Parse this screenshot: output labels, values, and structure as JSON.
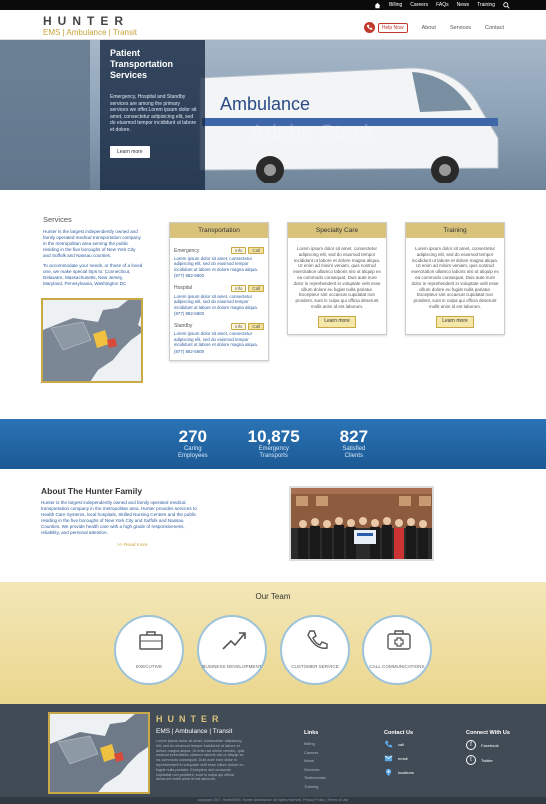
{
  "topbar": {
    "links": [
      "Billing",
      "Careers",
      "FAQs",
      "News",
      "Training"
    ]
  },
  "header": {
    "title": "HUNTER",
    "subtitle": "EMS | Ambulance | Transit",
    "help_label": "Help Now",
    "nav": [
      "About",
      "Services",
      "Contact"
    ]
  },
  "hero": {
    "title": "Patient Transportation Services",
    "text": "Emergency, Hospital and Standby services are among the primary services we offer.Lorem ipsum dolor sit amet, consectetur adipisicing elit, sed do eiusmod tempor incididunt ut labore et dolore.",
    "button": "Learn more",
    "van_label": "Ambulance",
    "watermark": "Adobe Stock"
  },
  "services": {
    "heading": "Services",
    "para1": "Hunter is the largest independently owned and family operated medical transportation company in the metropolitan area serving the public residing in the five boroughs of New York City and Suffolk and Nassau counties.",
    "para2": "To accommodate your needs, or those of a loved one, we make special trips to: Connecticut, Delaware, Massachusetts, New Jersey, Maryland, Pennsylvania, Washington DC"
  },
  "cards": {
    "transportation": {
      "title": "Transportation",
      "rows": [
        {
          "label": "Emergency",
          "info": "Info",
          "call": "Call",
          "text": "Lorem ipsum dolor sit amet, consectetur adipiscing elit, sed do eiusmod tempor incididunt ut labore et dolore magna aliqua.",
          "phone": "(877) 882-5800"
        },
        {
          "label": "Hospital",
          "info": "Info",
          "call": "Call",
          "text": "Lorem ipsum dolor sit amet, consectetur adipiscing elit, sed do eiusmod tempor incididunt ut labore et dolore magna aliqua.",
          "phone": "(877) 882-5800"
        },
        {
          "label": "Standby",
          "info": "Info",
          "call": "Call",
          "text": "Lorem ipsum dolor sit amet, consectetur adipiscing elit, sed do eiusmod tempor incididunt ut labore et dolore magna aliqua.",
          "phone": "(877) 882-5800"
        }
      ]
    },
    "specialty": {
      "title": "Specialty Care",
      "text": "Lorem ipsum dolor sit amet, consectetur adipiscing elit, sed do eiusmod tempor incididunt ut labore et dolore magna aliqua. Ut enim ad minim veniam, quis nostrud exercitation ullamco laboris nisi ut aliquip ex ea commodo consequat. Duis aute irure dolor in reprehenderit in voluptate velit esse cillum dolore eu fugiat nulla pariatur. Excepteur sint occaecat cupidatat non proident, sunt in culpa qui officia deserunt mollit anim id est laborum.",
      "button": "Learn more"
    },
    "training": {
      "title": "Training",
      "text": "Lorem ipsum dolor sit amet, consectetur adipiscing elit, sed do eiusmod tempor incididunt ut labore et dolore magna aliqua. Ut enim ad minim veniam, quis nostrud exercitation ullamco laboris nisi ut aliquip ex ea commodo consequat. Duis aute irure dolor in reprehenderit in voluptate velit esse cillum dolore eu fugiat nulla pariatur. Excepteur sint occaecat cupidatat non proident, sunt in culpa qui officia deserunt mollit anim id est laborum.",
      "button": "Learn more"
    }
  },
  "stats": [
    {
      "number": "270",
      "label1": "Caring",
      "label2": "Employees"
    },
    {
      "number": "10,875",
      "label1": "Emergency",
      "label2": "Transports"
    },
    {
      "number": "827",
      "label1": "Satisfied",
      "label2": "Clients"
    }
  ],
  "about": {
    "heading": "About The Hunter Family",
    "text": "Hunter is the largest independently owned and family operated medical transportation company in the metropolitan area. Hunter provides services to Health Care Systems, local hospitals, Skilled Nursing Centers and the public residing in the five boroughs of New York City and Suffolk and Nassau Counties. We provide health care with a high grade of responsiveness, reliability, and personal attention.",
    "read_more": ">> Read more"
  },
  "team": {
    "heading": "Our Team",
    "items": [
      {
        "label": "EXECUTIVE",
        "icon": "briefcase-icon"
      },
      {
        "label": "BUSINESS DEVELOPMENT",
        "icon": "trend-up-icon"
      },
      {
        "label": "CUSTOMER SERVICE",
        "icon": "phone-icon"
      },
      {
        "label": "CALL COMMUNICATIONS",
        "icon": "medical-kit-icon"
      }
    ]
  },
  "footer": {
    "brand": "HUNTER",
    "subtitle": "EMS | Ambulance | Transit",
    "text": "Lorem ipsum dolor sit amet, consectetur adipiscing elit, sed do eiusmod tempor incididunt ut labore et dolore magna aliqua. Ut enim ad minim veniam, quis nostrud exercitation ullamco laboris nisi ut aliquip ex ea commodo consequat. Duis aute irure dolor in reprehenderit in voluptate velit esse cillum dolore eu fugiat nulla pariatur. Excepteur sint occaecat cupidatat non proident, sunt in culpa qui officia deserunt mollit anim id est laborum.",
    "links_heading": "Links",
    "links": [
      "Billing",
      "Careers",
      "News",
      "Services",
      "Testimonials",
      "Training"
    ],
    "contact_heading": "Contact Us",
    "contact": [
      "call",
      "email",
      "locations"
    ],
    "social_heading": "Connect With Us",
    "social": [
      "Facebook",
      "Twitter"
    ],
    "copyright": "copyright 2017, HunterEMS. Hunter Ambulance. All rights reserved. Privacy Policy | Terms of Use"
  },
  "colors": {
    "gold": "#c9a84a",
    "blue": "#2c5b9e",
    "stats_bg": "#2b73b5",
    "footer_bg": "#414b56"
  }
}
